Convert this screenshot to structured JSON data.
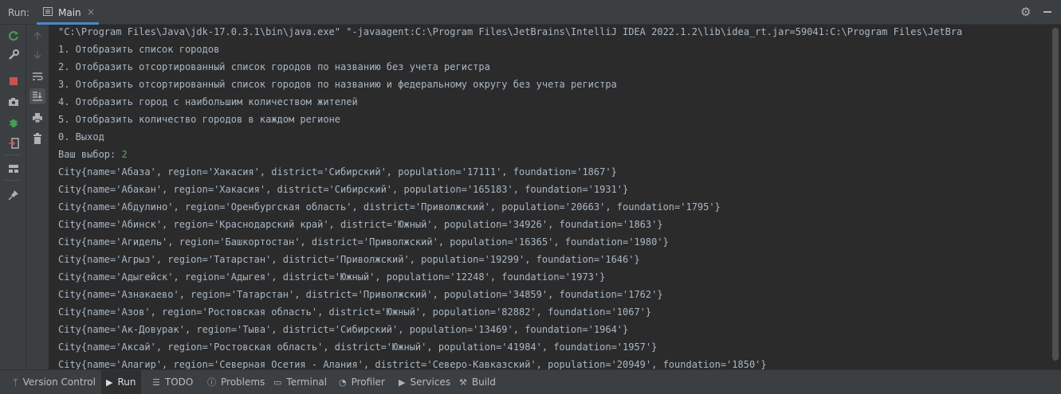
{
  "top": {
    "run_label": "Run:",
    "tab_label": "Main",
    "close_glyph": "×",
    "settings_icon": "gear-icon",
    "minimize_icon": "minimize-icon"
  },
  "console": {
    "lines": [
      "\"C:\\Program Files\\Java\\jdk-17.0.3.1\\bin\\java.exe\" \"-javaagent:C:\\Program Files\\JetBrains\\IntelliJ IDEA 2022.1.2\\lib\\idea_rt.jar=59041:C:\\Program Files\\JetBra",
      "1. Отобразить список городов",
      "2. Отобразить отсортированный список городов по названию без учета регистра",
      "3. Отобразить отсортированный список городов по названию и федеральному округу без учета регистра",
      "4. Отобразить город с наибольшим количеством жителей",
      "5. Отобразить количество городов в каждом регионе",
      "0. Выход",
      "Ваш выбор: ",
      "City{name='Абаза', region='Хакасия', district='Сибирский', population='17111', foundation='1867'}",
      "City{name='Абакан', region='Хакасия', district='Сибирский', population='165183', foundation='1931'}",
      "City{name='Абдулино', region='Оренбургская область', district='Приволжский', population='20663', foundation='1795'}",
      "City{name='Абинск', region='Краснодарский край', district='Южный', population='34926', foundation='1863'}",
      "City{name='Агидель', region='Башкортостан', district='Приволжский', population='16365', foundation='1980'}",
      "City{name='Агрыз', region='Татарстан', district='Приволжский', population='19299', foundation='1646'}",
      "City{name='Адыгейск', region='Адыгея', district='Южный', population='12248', foundation='1973'}",
      "City{name='Азнакаево', region='Татарстан', district='Приволжский', population='34859', foundation='1762'}",
      "City{name='Азов', region='Ростовская область', district='Южный', population='82882', foundation='1067'}",
      "City{name='Ак-Довурак', region='Тыва', district='Сибирский', population='13469', foundation='1964'}",
      "City{name='Аксай', region='Ростовская область', district='Южный', population='41984', foundation='1957'}",
      "City{name='Алагир', region='Северная Осетия - Алания', district='Северо-Кавказский', population='20949', foundation='1850'}"
    ],
    "user_input": "2"
  },
  "bottom_tabs": [
    {
      "label": "Version Control",
      "icon": "branch-icon"
    },
    {
      "label": "Run",
      "icon": "play-icon"
    },
    {
      "label": "TODO",
      "icon": "list-icon"
    },
    {
      "label": "Problems",
      "icon": "info-icon"
    },
    {
      "label": "Terminal",
      "icon": "terminal-icon"
    },
    {
      "label": "Profiler",
      "icon": "profiler-icon"
    },
    {
      "label": "Services",
      "icon": "services-icon"
    },
    {
      "label": "Build",
      "icon": "hammer-icon"
    }
  ],
  "colors": {
    "background": "#2b2b2b",
    "panel": "#3c3f41",
    "text": "#a9b7c6",
    "input_text": "#62a362",
    "tab_underline": "#4a88c7",
    "stop_red": "#c75450",
    "rerun_green": "#499c54"
  }
}
